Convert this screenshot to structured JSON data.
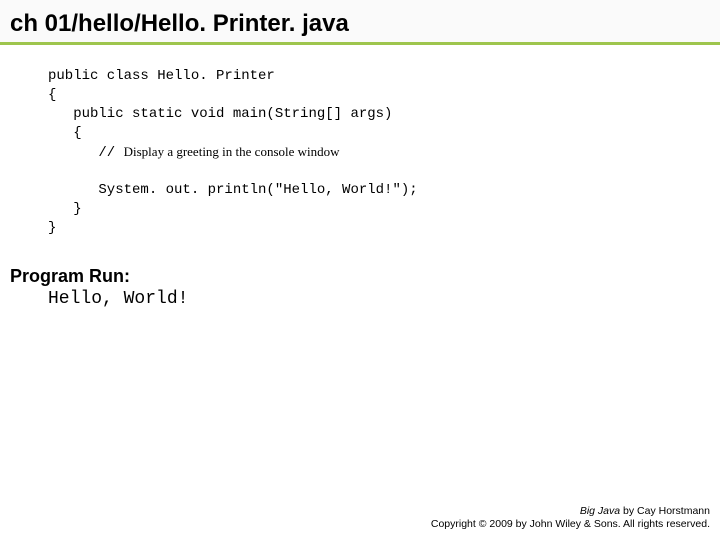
{
  "title": "ch 01/hello/Hello. Printer. java",
  "code": {
    "l1": "public class Hello. Printer",
    "l2": "{",
    "l3": "   public static void main(String[] args)",
    "l4": "   {",
    "l5_slashes": "      // ",
    "l5_comment": "Display a greeting in the console window",
    "l6": "",
    "l7": "      System. out. println(\"Hello, World!\");",
    "l8": "   }",
    "l9": "}"
  },
  "run": {
    "label": "Program Run:",
    "output": "Hello, World!"
  },
  "footer": {
    "book": "Big Java",
    "by": " by Cay Horstmann",
    "copyright": "Copyright © 2009 by John Wiley & Sons.  All rights reserved."
  }
}
